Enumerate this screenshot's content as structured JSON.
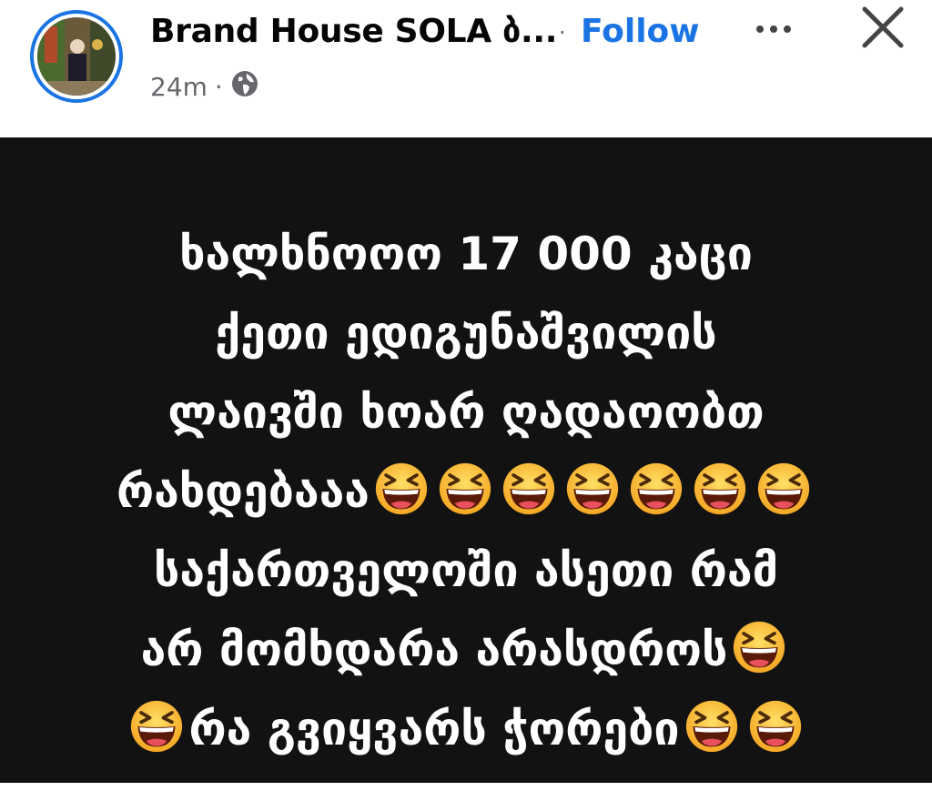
{
  "header": {
    "page_name": "Brand House SOLA ბ...",
    "separator": "·",
    "follow_label": "Follow",
    "timestamp": "24m",
    "meta_separator": "·",
    "privacy_icon": "globe-icon",
    "more_icon": "more-dots-icon",
    "close_icon": "close-icon",
    "avatar_ring_color": "#1b74e4"
  },
  "post": {
    "background_color": "#121212",
    "text_color": "#ffffff",
    "emoji_icon": "grinning-squinting-face-emoji",
    "lines": [
      "ხალხნოოო 17 000 კაცი",
      "ქეთი ედიგუნაშვილის",
      "ლაივში ხოარ ღადაოობთ",
      "რახდებააა",
      "საქართველოში ასეთი რამ",
      "არ მომხდარა არასდროს",
      "რა გვიყვარს ჭორები"
    ]
  }
}
